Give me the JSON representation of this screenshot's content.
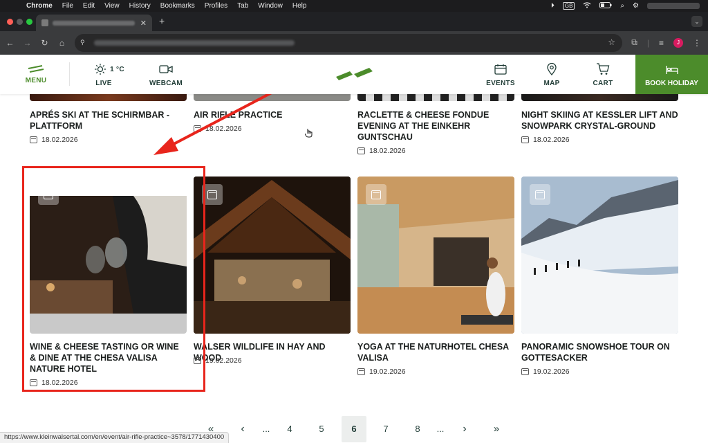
{
  "menubar": {
    "app": "Chrome",
    "items": [
      "File",
      "Edit",
      "View",
      "History",
      "Bookmarks",
      "Profiles",
      "Tab",
      "Window",
      "Help"
    ],
    "keyboard": "GB"
  },
  "browser": {
    "avatar_initial": "J"
  },
  "header": {
    "menu_label": "MENU",
    "weather_temp": "1 °C",
    "live_label": "LIVE",
    "webcam_label": "WEBCAM",
    "events_label": "EVENTS",
    "map_label": "MAP",
    "cart_label": "CART",
    "book_label": "BOOK HOLIDAY",
    "brand_color": "#4c8c2b"
  },
  "events_top_row": [
    {
      "title": "APRÉS SKI AT THE SCHIRMBAR - PLATTFORM",
      "date": "18.02.2026"
    },
    {
      "title": "AIR RIFLE PRACTICE",
      "date": "18.02.2026"
    },
    {
      "title": "RACLETTE & CHEESE FONDUE EVENING AT THE EINKEHR GUNTSCHAU",
      "date": "18.02.2026"
    },
    {
      "title": "NIGHT SKIING AT KESSLER LIFT AND SNOWPARK CRYSTAL-GROUND",
      "date": "18.02.2026"
    }
  ],
  "events_second_row": [
    {
      "title": "WINE & CHEESE TASTING OR WINE & DINE AT THE CHESA VALISA NATURE HOTEL",
      "date": "18.02.2026"
    },
    {
      "title": "WALSER WILDLIFE IN HAY AND WOOD",
      "date": "19.02.2026"
    },
    {
      "title": "YOGA AT THE NATURHOTEL CHESA VALISA",
      "date": "19.02.2026"
    },
    {
      "title": "PANORAMIC SNOWSHOE TOUR ON GOTTESACKER",
      "date": "19.02.2026"
    }
  ],
  "pagination": {
    "first": "«",
    "prev": "‹",
    "ellipsis_left": "...",
    "pages": [
      "4",
      "5",
      "6",
      "7",
      "8"
    ],
    "current": "6",
    "ellipsis_right": "...",
    "next": "›",
    "last": "»"
  },
  "status_url": "https://www.kleinwalsertal.com/en/event/air-rifle-practice~3578/1771430400",
  "annotation_color": "#e8251c"
}
